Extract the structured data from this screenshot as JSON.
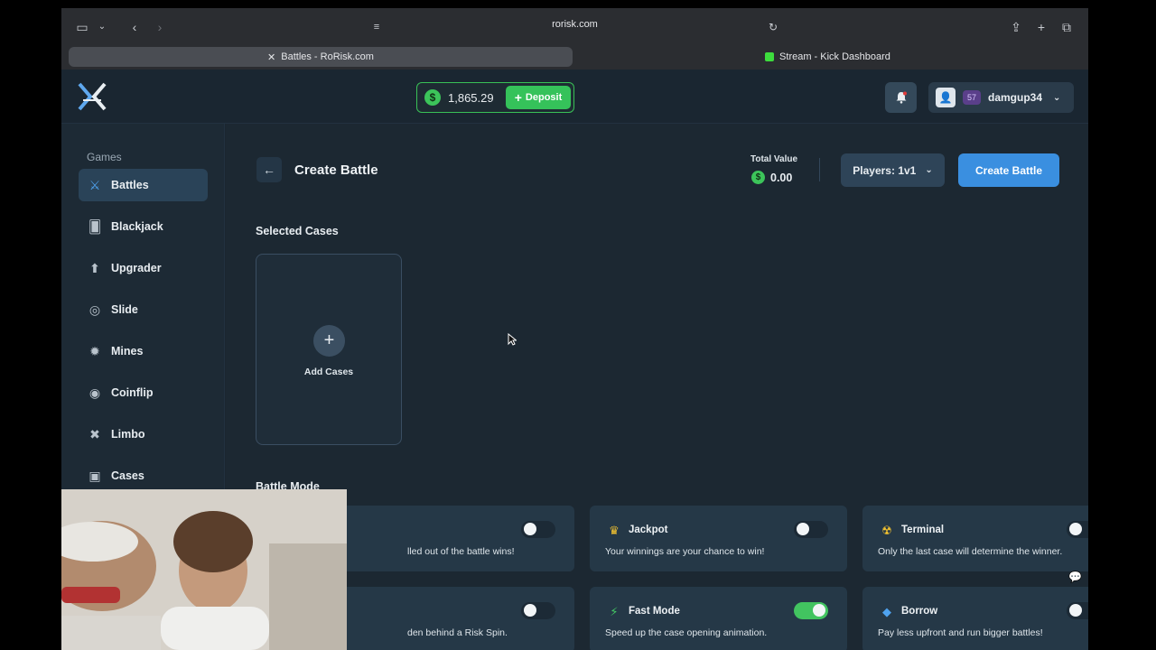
{
  "browser": {
    "url": "rorisk.com",
    "tabs": [
      {
        "label": "Battles - RoRisk.com",
        "active": true
      },
      {
        "label": "Stream - Kick Dashboard",
        "active": false
      }
    ]
  },
  "header": {
    "balance": "1,865.29",
    "deposit_label": "Deposit",
    "user": {
      "level": "57",
      "name": "damgup34"
    }
  },
  "sidebar": {
    "section_title": "Games",
    "items": [
      {
        "label": "Battles",
        "icon": "swords-icon",
        "active": true
      },
      {
        "label": "Blackjack",
        "icon": "cards-icon"
      },
      {
        "label": "Upgrader",
        "icon": "upgrade-icon"
      },
      {
        "label": "Slide",
        "icon": "slide-icon"
      },
      {
        "label": "Mines",
        "icon": "mine-icon"
      },
      {
        "label": "Coinflip",
        "icon": "coin-icon"
      },
      {
        "label": "Limbo",
        "icon": "limbo-icon"
      },
      {
        "label": "Cases",
        "icon": "case-icon"
      }
    ]
  },
  "main": {
    "title": "Create Battle",
    "total_value_label": "Total Value",
    "total_value": "0.00",
    "players_label": "Players:",
    "players_value": "1v1",
    "create_label": "Create Battle",
    "selected_cases_title": "Selected Cases",
    "add_cases_label": "Add Cases",
    "battle_mode_title": "Battle Mode",
    "modes": [
      {
        "name": "",
        "desc": "lled out of the battle wins!",
        "on": false
      },
      {
        "name": "Jackpot",
        "desc": "Your winnings are your chance to win!",
        "on": false,
        "icon": "crown-icon",
        "color": "#f2c230"
      },
      {
        "name": "Terminal",
        "desc": "Only the last case will determine the winner.",
        "on": false,
        "icon": "radiation-icon",
        "color": "#f2c230"
      },
      {
        "name": "",
        "desc": "den behind a Risk Spin.",
        "on": false
      },
      {
        "name": "Fast Mode",
        "desc": "Speed up the case opening animation.",
        "on": true,
        "icon": "lightning-icon",
        "color": "#44c964"
      },
      {
        "name": "Borrow",
        "desc": "Pay less upfront and run bigger battles!",
        "on": false,
        "icon": "ticket-icon",
        "color": "#4fa3ef"
      }
    ]
  }
}
